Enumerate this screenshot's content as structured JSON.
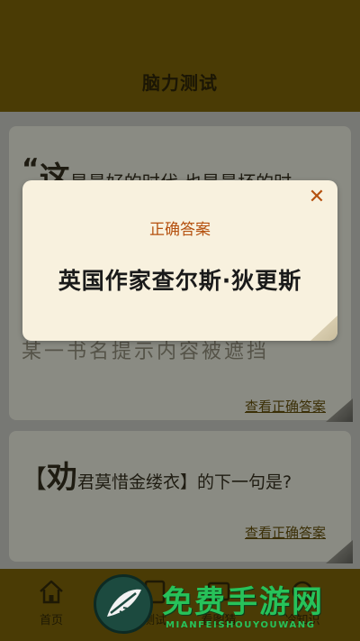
{
  "header": {
    "title": "脑力测试"
  },
  "cards": [
    {
      "quote_open": "“",
      "first_char": "这",
      "text_rest": "是最好的时代,也是最坏的时",
      "hidden_line": "某一书名提示内容被遮挡",
      "link": "查看正确答案"
    },
    {
      "bracket_open": "【",
      "first_char": "劝",
      "text_rest": "君莫惜金缕衣】的下一句是?",
      "link": "查看正确答案"
    }
  ],
  "modal": {
    "close_symbol": "✕",
    "label": "正确答案",
    "answer": "英国作家查尔斯·狄更斯"
  },
  "nav": {
    "items": [
      {
        "label": "首页",
        "icon": "home-icon"
      },
      {
        "label": "测试",
        "icon": "quiz-icon"
      },
      {
        "label": "看图猜",
        "icon": "image-icon"
      },
      {
        "label": "冷知识",
        "icon": "knowledge-icon"
      }
    ]
  },
  "watermark": {
    "title": "免费手游网",
    "subtitle": "MIANFEISHOUYOUWANG"
  },
  "colors": {
    "header_bg": "#4a3b05",
    "modal_bg": "#f8f1de",
    "accent": "#b5510f",
    "watermark": "#27c25a"
  }
}
